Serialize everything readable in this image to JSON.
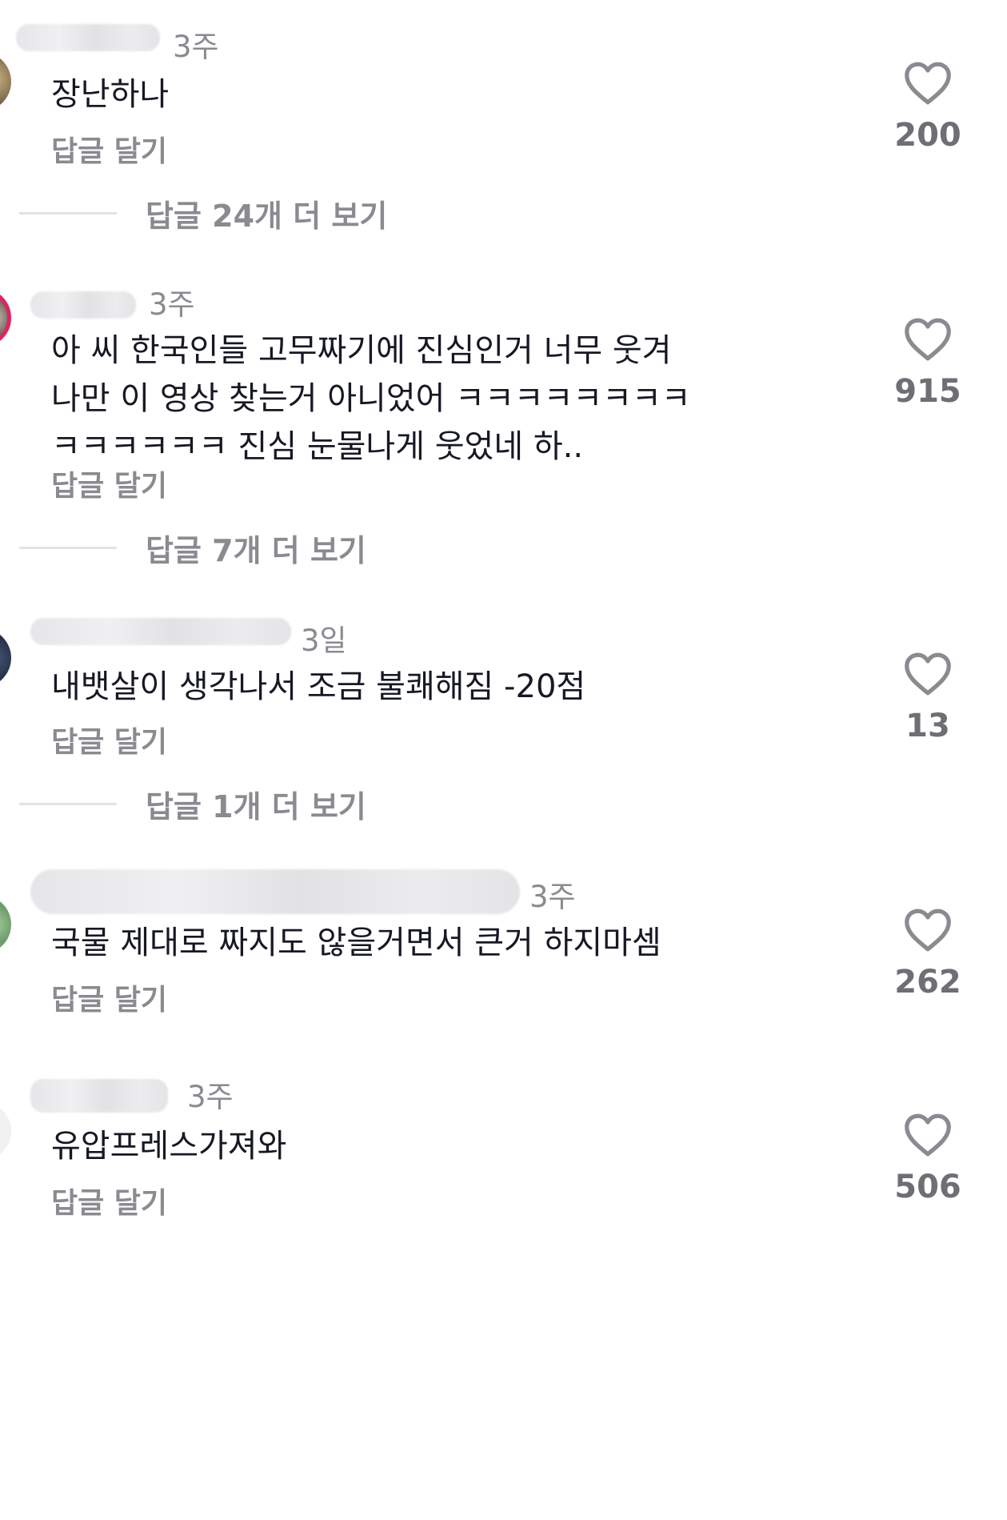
{
  "comments": [
    {
      "time": "3주",
      "text": "장난하나",
      "reply_label": "답글 달기",
      "likes": "200"
    },
    {
      "time": "3주",
      "text": "아 씨 한국인들 고무짜기에 진심인거 너무 웃겨 나만 이 영상 찾는거 아니었어 ㅋㅋㅋㅋㅋㅋㅋㅋㅋㅋㅋㅋㅋㅋ 진심 눈물나게 웃었네 하..",
      "reply_label": "답글 달기",
      "likes": "915"
    },
    {
      "time": "3일",
      "text": "내뱃살이 생각나서 조금 불쾌해짐 -20점",
      "reply_label": "답글 달기",
      "likes": "13"
    },
    {
      "time": "3주",
      "text": "국물 제대로 짜지도 않을거면서 큰거 하지마셈",
      "reply_label": "답글 달기",
      "likes": "262"
    },
    {
      "time": "3주",
      "text": "유압프레스가져와",
      "reply_label": "답글 달기",
      "likes": "506"
    }
  ],
  "view_more": [
    {
      "label": "답글 24개 더 보기"
    },
    {
      "label": "답글 7개 더 보기"
    },
    {
      "label": "답글 1개 더 보기"
    }
  ],
  "icons": {
    "like": "heart-outline-icon"
  },
  "colors": {
    "text": "#161823",
    "secondary": "#8a8b91",
    "divider": "#e3e3e5"
  }
}
